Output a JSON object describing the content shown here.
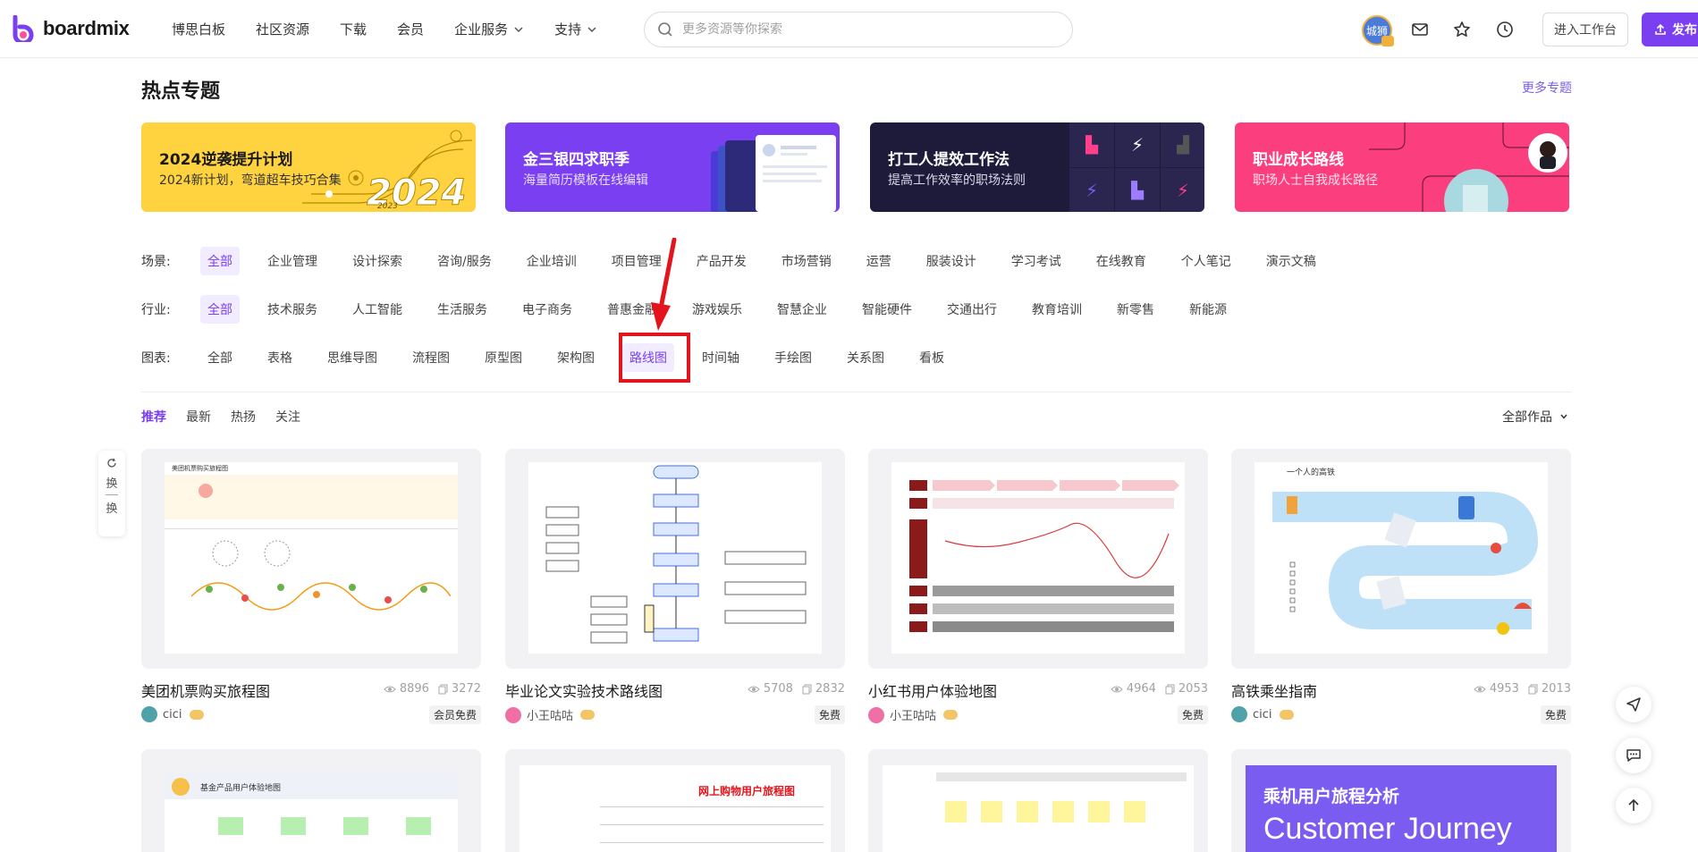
{
  "header": {
    "brand": "boardmix",
    "nav": [
      {
        "label": "博思白板",
        "dropdown": false
      },
      {
        "label": "社区资源",
        "dropdown": false
      },
      {
        "label": "下载",
        "dropdown": false
      },
      {
        "label": "会员",
        "dropdown": false
      },
      {
        "label": "企业服务",
        "dropdown": true
      },
      {
        "label": "支持",
        "dropdown": true
      }
    ],
    "search_placeholder": "更多资源等你探索",
    "avatar_text": "城狮",
    "workspace_label": "进入工作台",
    "publish_label": "发布",
    "brand_color": "#7b3ff2"
  },
  "hot": {
    "title": "热点专题",
    "more": "更多专题",
    "banners": [
      {
        "title": "2024逆袭提升计划",
        "subtitle": "2024新计划，弯道超车技巧合集",
        "bg": "#ffd23f",
        "art_year": "2024",
        "art_small": "2023"
      },
      {
        "title": "金三银四求职季",
        "subtitle": "海量简历模板在线编辑",
        "bg": "#7b3ff2"
      },
      {
        "title": "打工人提效工作法",
        "subtitle": "提高工作效率的职场法则",
        "bg": "#1d1a3a"
      },
      {
        "title": "职业成长路线",
        "subtitle": "职场人士自我成长路径",
        "bg": "#fb3f7e"
      }
    ]
  },
  "filters": {
    "scene": {
      "label": "场景:",
      "items": [
        "全部",
        "企业管理",
        "设计探索",
        "咨询/服务",
        "企业培训",
        "项目管理",
        "产品开发",
        "市场营销",
        "运营",
        "服装设计",
        "学习考试",
        "在线教育",
        "个人笔记",
        "演示文稿"
      ],
      "active": 0
    },
    "industry": {
      "label": "行业:",
      "items": [
        "全部",
        "技术服务",
        "人工智能",
        "生活服务",
        "电子商务",
        "普惠金融",
        "游戏娱乐",
        "智慧企业",
        "智能硬件",
        "交通出行",
        "教育培训",
        "新零售",
        "新能源"
      ],
      "active": 0
    },
    "chart": {
      "label": "图表:",
      "items": [
        "全部",
        "表格",
        "思维导图",
        "流程图",
        "原型图",
        "架构图",
        "路线图",
        "时间轴",
        "手绘图",
        "关系图",
        "看板"
      ],
      "active": 6
    }
  },
  "sort": {
    "tabs": [
      "推荐",
      "最新",
      "热扬",
      "关注"
    ],
    "active": 0,
    "all_works": "全部作品"
  },
  "refresh_label": [
    "换",
    "换"
  ],
  "cards": [
    {
      "title": "美团机票购买旅程图",
      "views": "8896",
      "copies": "3272",
      "author": "cici",
      "price": "会员免费",
      "thumb_title": "美团机票购买旅程图"
    },
    {
      "title": "毕业论文实验技术路线图",
      "views": "5708",
      "copies": "2832",
      "author": "小王咕咕",
      "price": "免费"
    },
    {
      "title": "小红书用户体验地图",
      "views": "4964",
      "copies": "2053",
      "author": "小王咕咕",
      "price": "免费"
    },
    {
      "title": "高铁乘坐指南",
      "views": "4953",
      "copies": "2013",
      "author": "cici",
      "price": "免费",
      "thumb_title": "一个人的高铁"
    }
  ],
  "cards_row2": [
    {
      "thumb_title": "基金产品用户体验地图"
    },
    {
      "thumb_title": "网上购物用户旅程图"
    },
    {
      "thumb_title": ""
    },
    {
      "thumb_title": "乘机用户旅程分析",
      "thumb_sub": "Customer Journey"
    }
  ]
}
